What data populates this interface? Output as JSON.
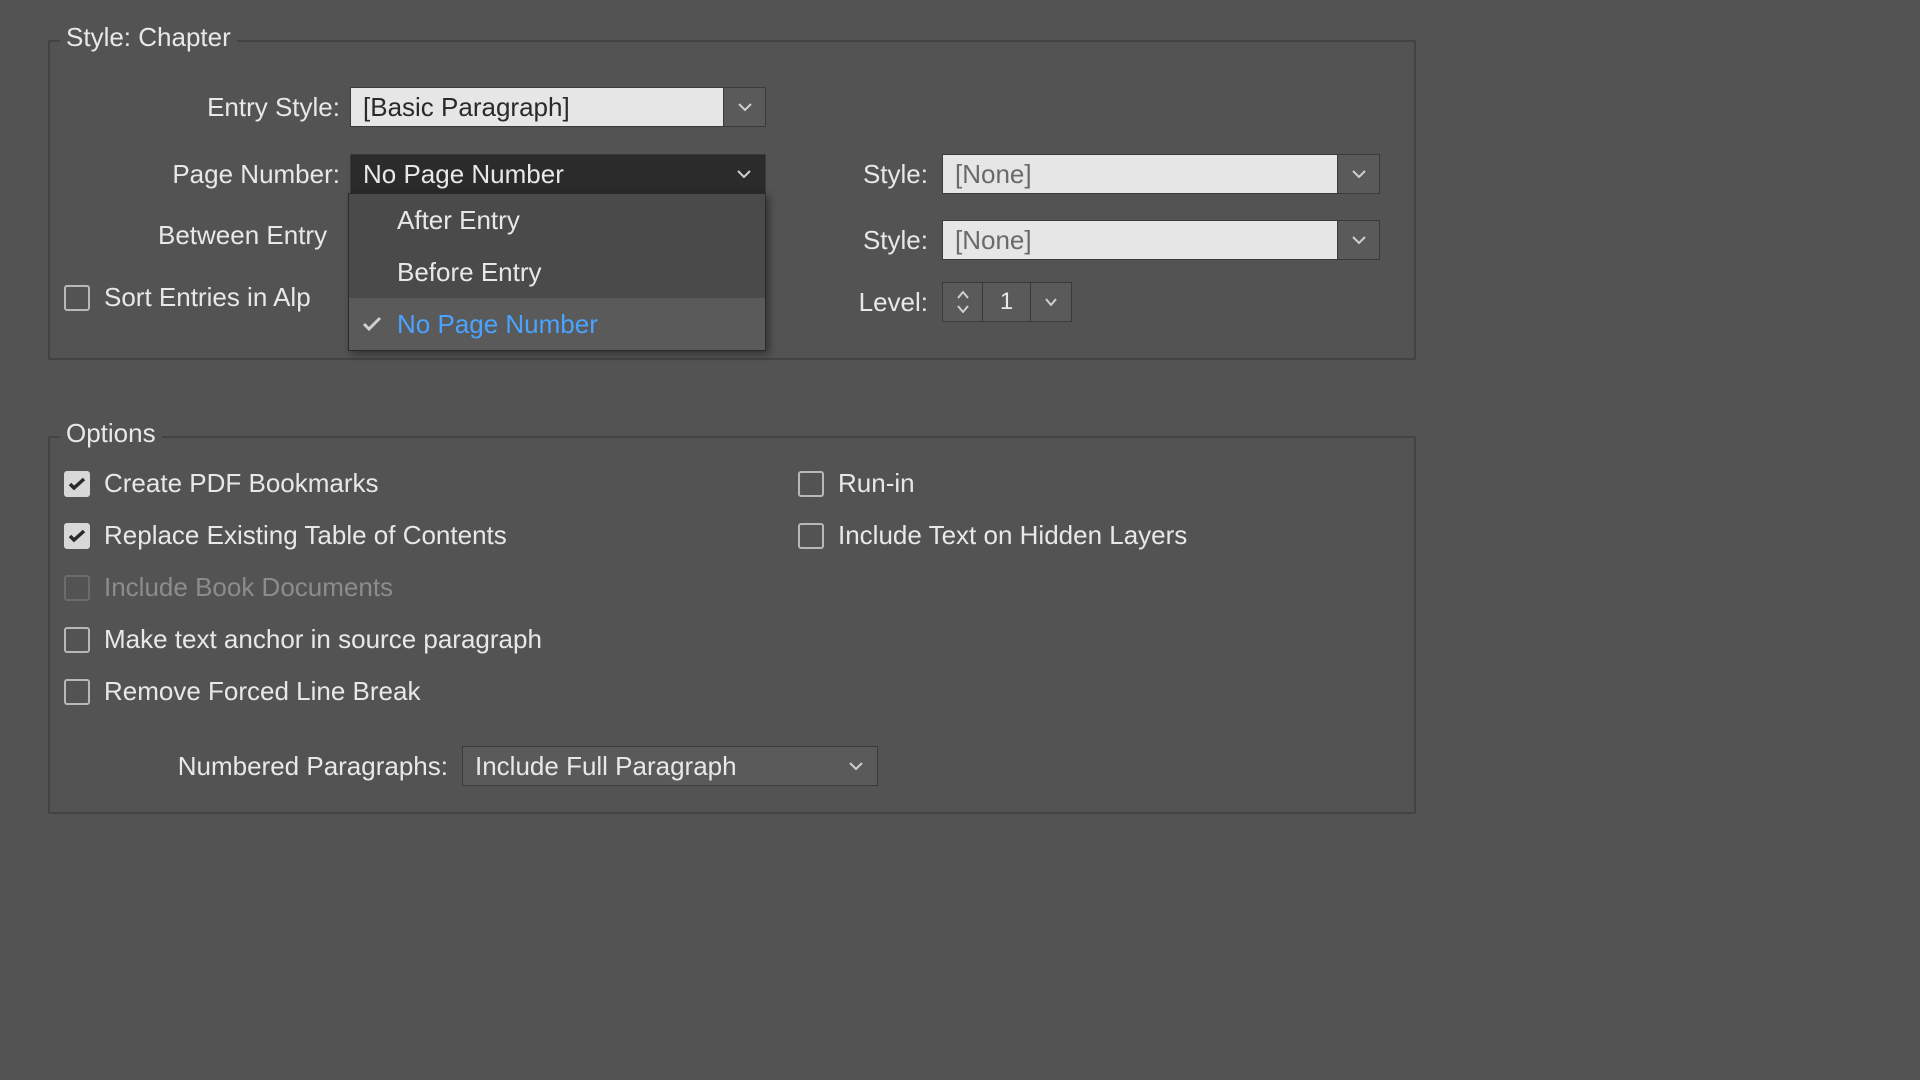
{
  "style_section": {
    "title": "Style: Chapter",
    "entry_style_label": "Entry Style:",
    "entry_style_value": "[Basic Paragraph]",
    "page_number_label": "Page Number:",
    "page_number_value": "No Page Number",
    "page_number_options": {
      "opt1": "After Entry",
      "opt2": "Before Entry",
      "opt3": "No Page Number"
    },
    "between_entry_label": "Between Entry",
    "style1_label": "Style:",
    "style1_value": "[None]",
    "style2_label": "Style:",
    "style2_value": "[None]",
    "sort_label": "Sort Entries in Alp",
    "level_label": "Level:",
    "level_value": "1"
  },
  "options_section": {
    "title": "Options",
    "create_pdf": "Create PDF Bookmarks",
    "replace_toc": "Replace Existing Table of Contents",
    "include_book": "Include Book Documents",
    "text_anchor": "Make text anchor in source paragraph",
    "remove_break": "Remove Forced Line Break",
    "run_in": "Run-in",
    "hidden_layers": "Include Text on Hidden Layers",
    "numbered_label": "Numbered Paragraphs:",
    "numbered_value": "Include Full Paragraph"
  }
}
